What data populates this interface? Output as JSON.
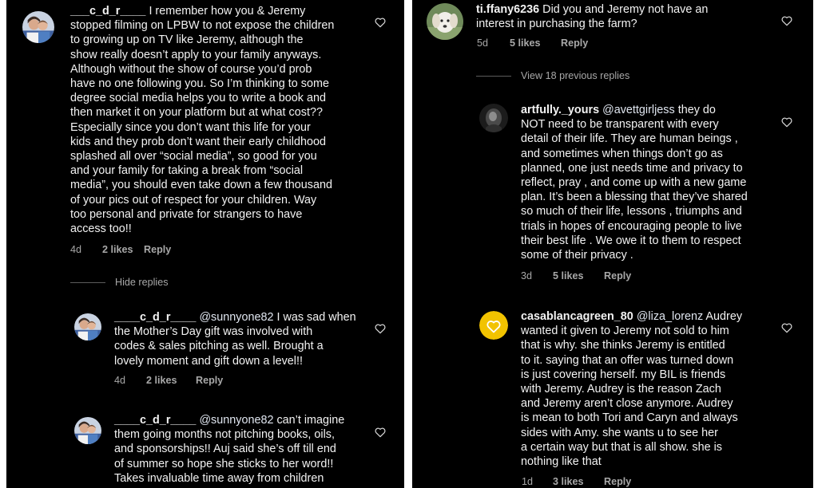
{
  "left": {
    "c1": {
      "username": "___c_d_r____",
      "text": "I remember how you & Jeremy\nstopped filming on LPBW to not expose the children\nto growing up on TV like Jeremy, although the\nshow really doesn’t apply to your family anyways.\nAlthough without the show of course you’d prob\nhave no one following you.  So I’m thinking to some\ndegree social media helps you to write a book and\nthen market it on your platform but at what cost??\nEspecially since you don’t want this life for your\nkids and they prob don’t want their early childhood\nsplashed all over “social media”, so good for you\nand your family for taking a break from “social\nmedia”, you should even take down a few thousand\nof your pics out of respect for your children.  Way\ntoo personal and private for strangers to have\naccess too!!",
      "time": "4d",
      "likes": "2 likes",
      "reply": "Reply"
    },
    "hide_replies": "Hide replies",
    "r1": {
      "username": "____c_d_r____",
      "mention": "@sunnyone82",
      "text": " I was sad when\nthe Mother’s Day gift was involved with\ncodes & sales pitching as well.  Brought a\nlovely moment and gift down a level!!",
      "time": "4d",
      "likes": "2 likes",
      "reply": "Reply"
    },
    "r2": {
      "username": "____c_d_r____",
      "mention": "@sunnyone82",
      "text": " can’t imagine\nthem going months not pitching books, oils,\nand sponsorships!! Auj said she’s off till end\nof summer so hope she sticks to her word!!\nTakes invaluable time away from children"
    }
  },
  "right": {
    "c1": {
      "username": "ti.ffany6236",
      "text": " Did you and Jeremy not have an\ninterest in purchasing the farm?",
      "time": "5d",
      "likes": "5 likes",
      "reply": "Reply"
    },
    "view_previous": "View 18 previous replies",
    "r1": {
      "username": "artfully._yours",
      "mention": "@avettgirljess",
      "text": "  they do\nNOT need  to be transparent with every\ndetail of their life. They are human beings ,\nand sometimes when things don’t go as\nplanned, one just needs time and privacy to\nreflect, pray , and come up with a new game\nplan. It’s been a blessing that they’ve shared\nso much of their life, lessons , triumphs and\ntrials in hopes of encouraging people to live\ntheir best life . We owe it to them to respect\nsome of their privacy .",
      "time": "3d",
      "likes": "5 likes",
      "reply": "Reply"
    },
    "r2": {
      "username": "casablancagreen_80",
      "mention": "@liza_lorenz",
      "text": " Audrey\nwanted it given to Jeremy not sold to him\nthat is why.  she thinks Jeremy is entitled\nto it. saying that an offer was turned down\nis just covering herself.  my BIL is friends\nwith Jeremy.  Audrey is the reason Zach\nand Jeremy aren’t close anymore. Audrey\nis mean to both Tori and Caryn and always\nsides with Amy.  she wants u to see her\na certain way but that is all show. she is\nnothing like that",
      "time": "1d",
      "likes": "3 likes",
      "reply": "Reply"
    }
  },
  "icons": {
    "heart": "heart-outline-icon",
    "avatar_couple": "couple-photo-avatar",
    "avatar_dog": "dog-photo-avatar",
    "avatar_dark": "dark-photo-avatar",
    "avatar_heart": "yellow-heart-avatar"
  },
  "colors": {
    "background": "#000000",
    "text": "#f2f2f2",
    "meta": "#a8a8a8",
    "heart_avatar": "#f2c300"
  }
}
